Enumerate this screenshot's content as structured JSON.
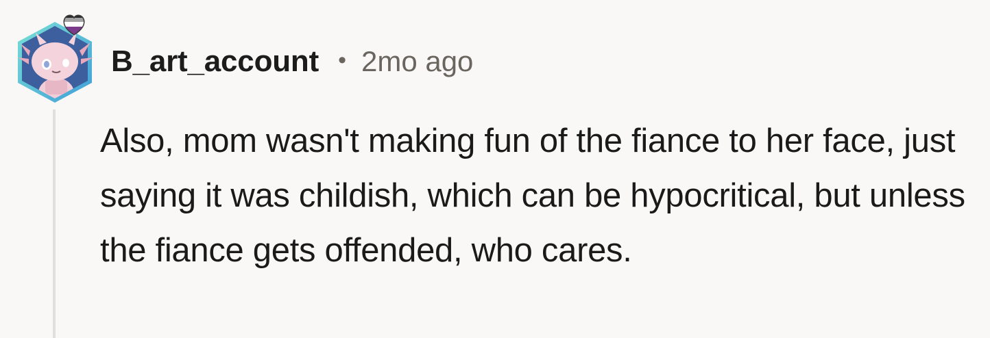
{
  "comment": {
    "author": "B_art_account",
    "separator": "•",
    "timestamp": "2mo ago",
    "body": "Also, mom wasn't making fun of the fiance to her face, just saying it was childish, which can be hypocritical, but unless the fiance gets offended, who cares.",
    "avatar_icon": "axolotl-avatar-icon",
    "badge_icon": "heart-flag-icon"
  },
  "colors": {
    "background": "#f9f8f6",
    "thread_line": "#e1dfdb",
    "meta_text": "#6b6560",
    "avatar_hex_border": "#5fc9c4",
    "avatar_hex_fill": "#3d5f9e",
    "axolotl_pink": "#f2cfd8"
  }
}
